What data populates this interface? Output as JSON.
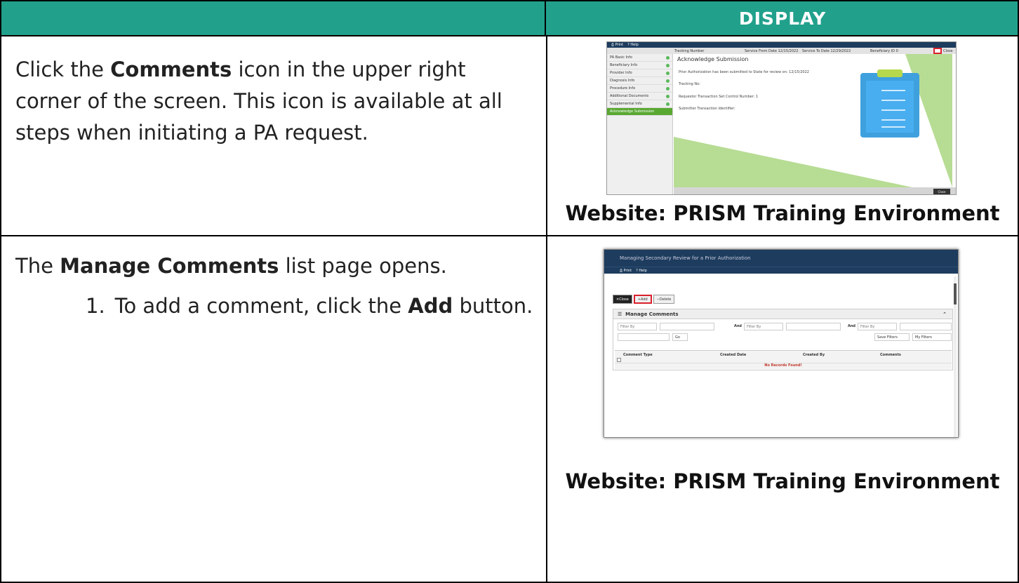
{
  "header": {
    "left_label": "",
    "right_label": "DISPLAY"
  },
  "row1": {
    "instruction_parts": [
      "Click the ",
      "Comments",
      " icon in the upper right corner of the screen. This icon is available at all steps when initiating a PA request."
    ],
    "caption": "Website: PRISM Training Environment",
    "screenshot": {
      "top_links": [
        "Print",
        "Help"
      ],
      "bar": {
        "tracking": "Tracking Number",
        "service_from": "Service From Date 12/15/2022",
        "service_to": "Service To Date 12/29/2022",
        "beneficiary": "Beneficiary ID 0",
        "close": "Close"
      },
      "nav": [
        "PA Basic Info",
        "Beneficiary Info",
        "Provider Info",
        "Diagnosis Info",
        "Procedure Info",
        "Additional Documents",
        "Supplemental Info",
        "Acknowledge Submission"
      ],
      "title": "Acknowledge Submission",
      "lines": [
        "Prior Authorization has been submitted to State for review on: 12/15/2022",
        "Tracking No:",
        "Requestor Transaction Set Control Number: 1",
        "Submitter Transaction Identifier:"
      ],
      "close_button": "Close"
    }
  },
  "row2": {
    "instruction_parts": [
      "The ",
      "Manage Comments",
      " list page opens."
    ],
    "step_number": "1.",
    "step_parts": [
      "To add a comment, click the ",
      "Add",
      " button."
    ],
    "caption": "Website: PRISM Training Environment",
    "screenshot": {
      "title": "Managing Secondary Review for a Prior Authorization",
      "top_links": [
        "Print",
        "Help"
      ],
      "buttons": [
        "Close",
        "Add",
        "Delete"
      ],
      "panel_title": "Manage Comments",
      "filter_placeholder": "Filter By",
      "and_label": "And",
      "go": "Go",
      "save_filters": "Save Filters",
      "my_filters": "My Filters",
      "columns": [
        "Comment Type",
        "Created Date",
        "Created By",
        "Comments"
      ],
      "no_records": "No Records Found!"
    }
  },
  "colors": {
    "header_bg": "#21a18c",
    "nav_active": "#59a832",
    "portal_navy": "#1d3c5e",
    "highlight_red": "#d9202c"
  }
}
